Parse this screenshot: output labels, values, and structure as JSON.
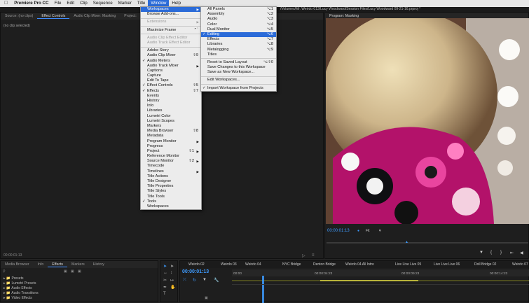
{
  "menubar": {
    "app": "Premiere Pro CC",
    "items": [
      "File",
      "Edit",
      "Clip",
      "Sequence",
      "Marker",
      "Title",
      "Window",
      "Help"
    ]
  },
  "path": "/Volumes/Mr. Weirdo 013/Lucy Woodward/Session Files/Lucy Woodward 09-21-16.prproj *",
  "source_panel": {
    "tabs": [
      "Source: (no clips)",
      "Effect Controls",
      "Audio Clip Mixer: Masking",
      "Project:"
    ],
    "status": "(no clip selected)",
    "timecode": "00:00:01:13"
  },
  "program_panel": {
    "title": "Program: Masking",
    "timecode": "00:00:01:13",
    "fit": "Fit"
  },
  "effects_panel": {
    "tabs": [
      "Media Browser",
      "Info",
      "Effects",
      "Markers",
      "History"
    ],
    "items": [
      "Presets",
      "Lumetri Presets",
      "Audio Effects",
      "Audio Transitions",
      "Video Effects"
    ]
  },
  "timeline": {
    "timecode": "00:00:01:13",
    "markers": [
      "Weirdo 02",
      "Weirdo 03",
      "Weirdo 04",
      "NYC Bridge",
      "Denton Bridge",
      "Weirdo 04 All Intro",
      "Live Live Live 05",
      "Live Live Live 06",
      "Doll Bridge 02",
      "Weirdo 07"
    ],
    "ruler": [
      "00:00",
      "00:00:04:23",
      "00:00:09:23",
      "00:00:14:23"
    ]
  },
  "window_menu": {
    "items": [
      {
        "label": "Workspaces",
        "arrow": true,
        "hl": true
      },
      {
        "label": "Browse Add-ons..."
      },
      {
        "sep": true
      },
      {
        "label": "Extensions",
        "arrow": true,
        "dis": true
      },
      {
        "sep": true
      },
      {
        "label": "Maximize Frame",
        "sc": "⌃`"
      },
      {
        "sep": true
      },
      {
        "label": "Audio Clip Effect Editor",
        "dis": true
      },
      {
        "label": "Audio Track Effect Editor",
        "dis": true
      },
      {
        "sep": true
      },
      {
        "label": "Adobe Story"
      },
      {
        "label": "Audio Clip Mixer",
        "sc": "⇧9"
      },
      {
        "label": "Audio Meters",
        "check": true
      },
      {
        "label": "Audio Track Mixer",
        "arrow": true
      },
      {
        "label": "Captions"
      },
      {
        "label": "Capture"
      },
      {
        "label": "Edit To Tape"
      },
      {
        "label": "Effect Controls",
        "check": true,
        "sc": "⇧5"
      },
      {
        "label": "Effects",
        "check": true,
        "sc": "⇧7"
      },
      {
        "label": "Events"
      },
      {
        "label": "History"
      },
      {
        "label": "Info"
      },
      {
        "label": "Libraries"
      },
      {
        "label": "Lumetri Color"
      },
      {
        "label": "Lumetri Scopes"
      },
      {
        "label": "Markers"
      },
      {
        "label": "Media Browser",
        "sc": "⇧8"
      },
      {
        "label": "Metadata"
      },
      {
        "label": "Program Monitor",
        "arrow": true
      },
      {
        "label": "Progress"
      },
      {
        "label": "Project",
        "arrow": true,
        "sc": "⇧1"
      },
      {
        "label": "Reference Monitor"
      },
      {
        "label": "Source Monitor",
        "arrow": true,
        "sc": "⇧2"
      },
      {
        "label": "Timecode"
      },
      {
        "label": "Timelines",
        "arrow": true
      },
      {
        "label": "Title Actions"
      },
      {
        "label": "Title Designer"
      },
      {
        "label": "Title Properties"
      },
      {
        "label": "Title Styles"
      },
      {
        "label": "Title Tools"
      },
      {
        "label": "Tools",
        "check": true
      },
      {
        "label": "Workspaces"
      }
    ]
  },
  "workspaces_menu": {
    "items": [
      {
        "label": "All Panels",
        "sc": "⌥1"
      },
      {
        "label": "Assembly",
        "sc": "⌥2"
      },
      {
        "label": "Audio",
        "sc": "⌥3"
      },
      {
        "label": "Color",
        "sc": "⌥4"
      },
      {
        "label": "Dual Monitor",
        "sc": "⌥5"
      },
      {
        "label": "Editing",
        "sc": "⌥6",
        "check": true,
        "hl": true
      },
      {
        "label": "Effects",
        "sc": "⌥7"
      },
      {
        "label": "Libraries",
        "sc": "⌥8"
      },
      {
        "label": "Metalogging",
        "sc": "⌥9"
      },
      {
        "label": "Titles"
      },
      {
        "sep": true
      },
      {
        "label": "Reset to Saved Layout",
        "sc": "⌥⇧0"
      },
      {
        "label": "Save Changes to this Workspace"
      },
      {
        "label": "Save as New Workspace..."
      },
      {
        "sep": true
      },
      {
        "label": "Edit Workspaces..."
      },
      {
        "sep": true
      },
      {
        "label": "Import Workspace from Projects",
        "check": true
      }
    ]
  }
}
